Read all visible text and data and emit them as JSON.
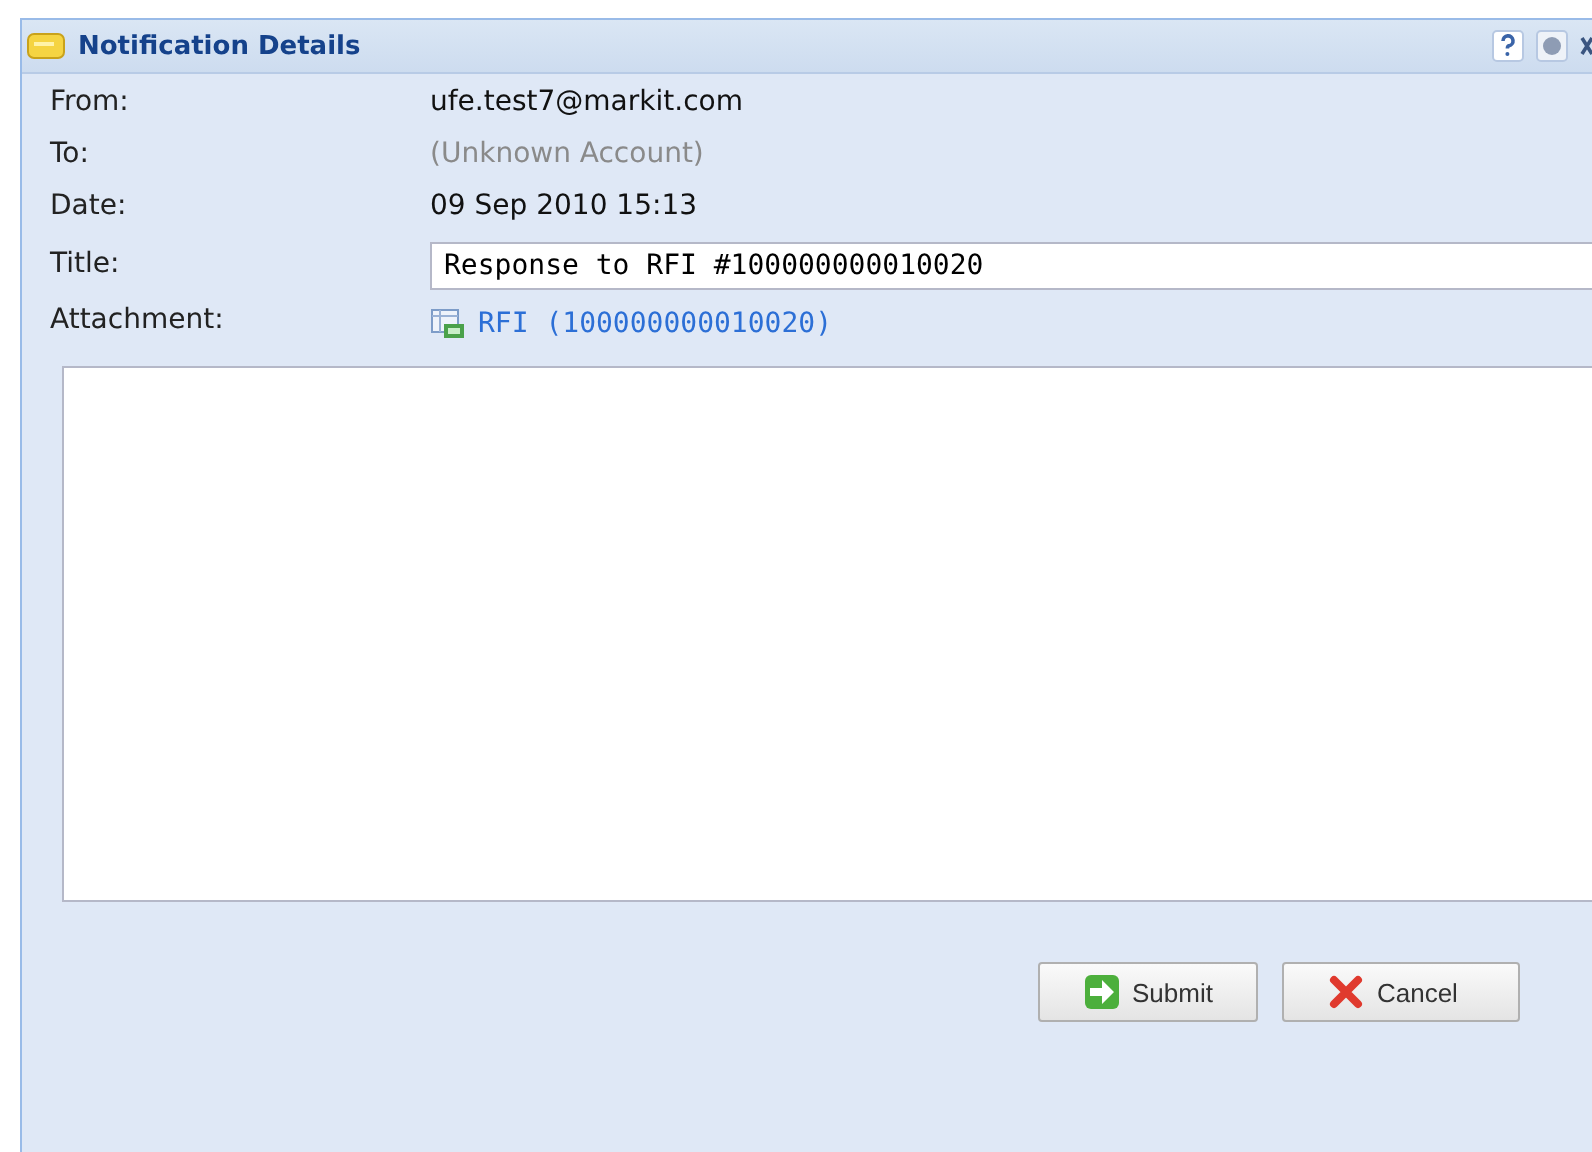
{
  "window": {
    "title": "Notification Details"
  },
  "fields": [
    {
      "label": "From:",
      "value": "ufe.test7@markit.com",
      "kind": "text"
    },
    {
      "label": "To:",
      "value": "(Unknown Account)",
      "kind": "muted"
    },
    {
      "label": "Date:",
      "value": "09 Sep 2010 15:13",
      "kind": "text"
    },
    {
      "label": "Title:",
      "value": "Response to RFI #100000000010020",
      "kind": "input"
    },
    {
      "label": "Attachment:",
      "value": "RFI (100000000010020)",
      "kind": "link"
    }
  ],
  "buttons": [
    {
      "label": "Submit",
      "kind": "submit"
    },
    {
      "label": "Cancel",
      "kind": "cancel"
    }
  ]
}
